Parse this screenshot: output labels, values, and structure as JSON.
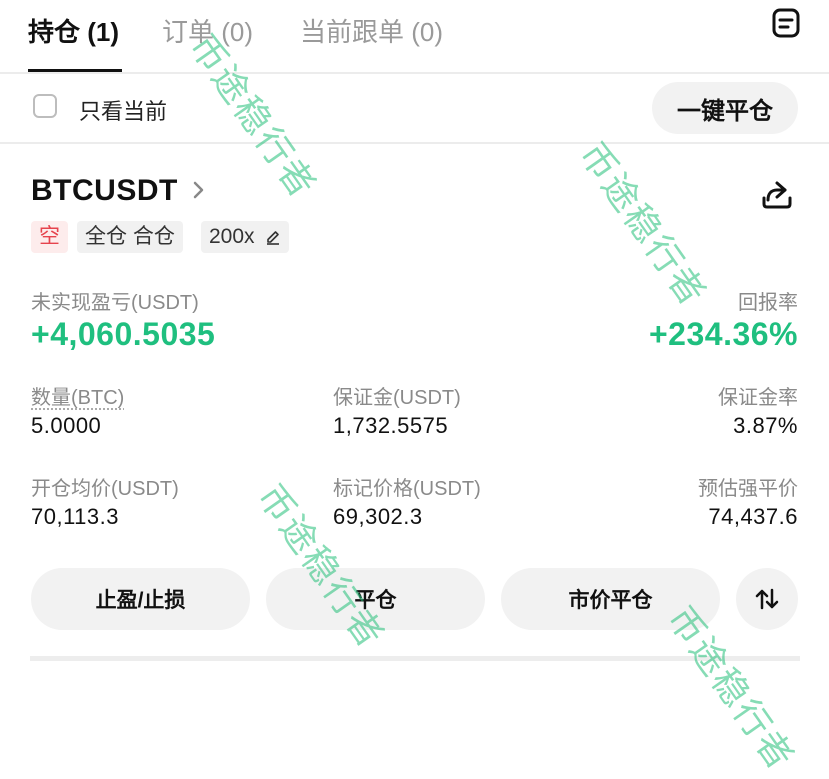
{
  "tabs": [
    {
      "label": "持仓 (1)",
      "active": true
    },
    {
      "label": "订单 (0)",
      "active": false
    },
    {
      "label": "当前跟单 (0)",
      "active": false
    }
  ],
  "icons": {
    "orders": "orders-list-icon",
    "chevron": "chevron-right-icon",
    "share": "share-icon",
    "edit": "pencil-icon",
    "swap": "swap-vertical-icon"
  },
  "filter": {
    "checkbox_label": "只看当前",
    "checked": false,
    "close_all_label": "一键平仓"
  },
  "position": {
    "symbol": "BTCUSDT",
    "tags": {
      "side": "空",
      "mode": "全仓 合仓",
      "leverage": "200x"
    },
    "pnl_label": "未实现盈亏(USDT)",
    "pnl_value": "+4,060.5035",
    "roe_label": "回报率",
    "roe_value": "+234.36%",
    "qty_label": "数量(BTC)",
    "qty_value": "5.0000",
    "margin_label": "保证金(USDT)",
    "margin_value": "1,732.5575",
    "margin_ratio_label": "保证金率",
    "margin_ratio_value": "3.87%",
    "entry_label": "开仓均价(USDT)",
    "entry_value": "70,113.3",
    "mark_label": "标记价格(USDT)",
    "mark_value": "69,302.3",
    "liq_label": "预估强平价",
    "liq_value": "74,437.6"
  },
  "actions": {
    "tp_sl": "止盈/止损",
    "close": "平仓",
    "market_close": "市价平仓"
  },
  "watermark": "币途稳行者",
  "colors": {
    "profit": "#1fbf7f",
    "short_text": "#e6434d",
    "short_bg": "#fdecec",
    "button_bg": "#f2f2f2",
    "watermark": "#25c07a"
  }
}
